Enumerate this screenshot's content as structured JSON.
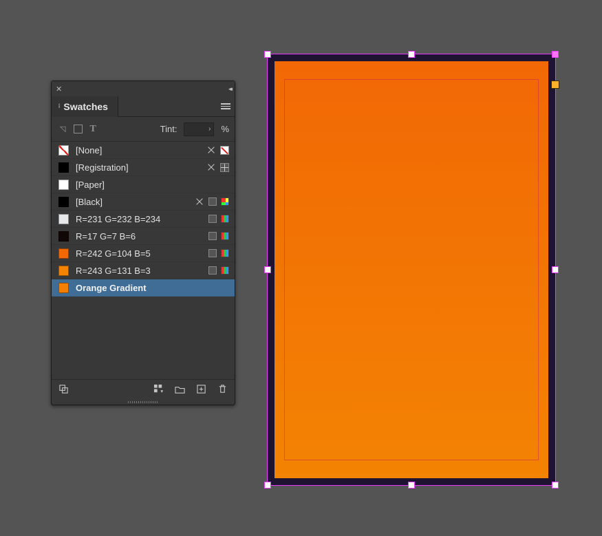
{
  "panel": {
    "tab_label": "Swatches",
    "tint_label": "Tint:",
    "tint_unit": "%"
  },
  "swatches": [
    {
      "name": "[None]",
      "css": "sw-none",
      "color": "#ffffff",
      "icons": [
        "pencilcross",
        "none"
      ]
    },
    {
      "name": "[Registration]",
      "css": "sw-reg",
      "color": "#000000",
      "icons": [
        "pencilcross",
        "reg"
      ]
    },
    {
      "name": "[Paper]",
      "css": "sw-paper",
      "color": "#ffffff",
      "icons": []
    },
    {
      "name": "[Black]",
      "css": "sw-black",
      "color": "#000000",
      "icons": [
        "pencilcross",
        "sq",
        "rgb"
      ]
    },
    {
      "name": "R=231 G=232 B=234",
      "css": "",
      "color": "#e7e8ea",
      "icons": [
        "sq",
        "rgbstripe"
      ]
    },
    {
      "name": "R=17 G=7 B=6",
      "css": "",
      "color": "#110706",
      "icons": [
        "sq",
        "rgbstripe"
      ]
    },
    {
      "name": "R=242 G=104 B=5",
      "css": "",
      "color": "#f26805",
      "icons": [
        "sq",
        "rgbstripe"
      ]
    },
    {
      "name": "R=243 G=131 B=3",
      "css": "",
      "color": "#f38303",
      "icons": [
        "sq",
        "rgbstripe"
      ]
    },
    {
      "name": "Orange Gradient",
      "css": "",
      "color": "#f37f05",
      "icons": [],
      "selected": true
    }
  ],
  "artboard": {
    "gradient_from": "#f26805",
    "gradient_to": "#f38303"
  }
}
